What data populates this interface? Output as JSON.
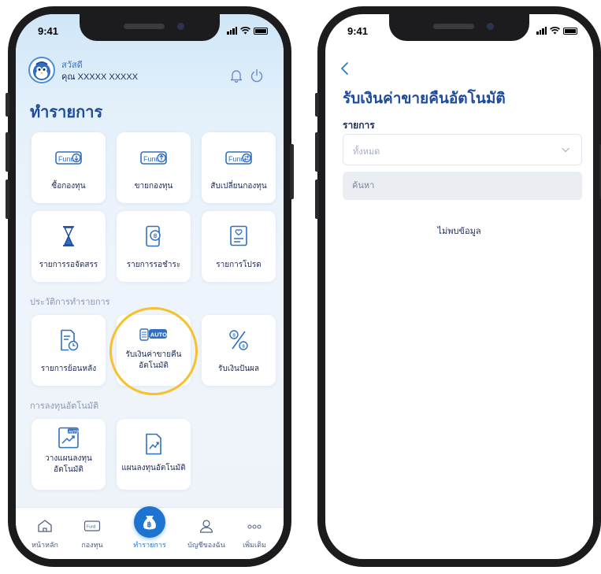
{
  "status_bar": {
    "time": "9:41"
  },
  "home": {
    "greeting": "สวัสดี",
    "user_name": "คุณ XXXXX XXXXX",
    "heading": "ทำรายการ",
    "transaction_tiles": [
      {
        "label": "ซื้อกองทุน",
        "icon": "fund-buy-icon"
      },
      {
        "label": "ขายกองทุน",
        "icon": "fund-sell-icon"
      },
      {
        "label": "สับเปลี่ยนกองทุน",
        "icon": "fund-switch-icon"
      },
      {
        "label": "รายการรอจัดสรร",
        "icon": "hourglass-icon"
      },
      {
        "label": "รายการรอชำระ",
        "icon": "payment-pending-icon"
      },
      {
        "label": "รายการโปรด",
        "icon": "favorite-list-icon"
      }
    ],
    "history_section": "ประวัติการทำรายการ",
    "history_tiles": [
      {
        "label": "รายการย้อนหลัง",
        "icon": "history-document-icon"
      },
      {
        "label_line1": "รับเงินค่าขายคืน",
        "label_line2": "อัตโนมัติ",
        "icon": "auto-redemption-icon",
        "auto_text": "AUTO"
      },
      {
        "label": "รับเงินปันผล",
        "icon": "dividend-percent-icon"
      }
    ],
    "auto_invest_section": "การลงทุนอัตโนมัติ",
    "auto_invest_tiles": [
      {
        "label_line1": "วางแผนลงทุน",
        "label_line2": "อัตโนมัติ",
        "icon": "auto-plan-icon",
        "auto_text": "AUTO"
      },
      {
        "label": "แผนลงทุนอัตโนมัติ",
        "icon": "auto-plan-chart-icon"
      }
    ],
    "tabs": [
      {
        "label": "หน้าหลัก",
        "icon": "home-icon"
      },
      {
        "label": "กองทุน",
        "icon": "fund-icon"
      },
      {
        "label": "ทำรายการ",
        "icon": "transaction-icon",
        "active": true
      },
      {
        "label": "บัญชีของฉัน",
        "icon": "account-icon"
      },
      {
        "label": "เพิ่มเติม",
        "icon": "more-icon"
      }
    ],
    "fund_icon_text": "Fund"
  },
  "detail": {
    "title": "รับเงินค่าขายคืนอัตโนมัติ",
    "filter_label": "รายการ",
    "filter_value": "ทั้งหมด",
    "search_placeholder": "ค้นหา",
    "empty_message": "ไม่พบข้อมูล"
  },
  "colors": {
    "primary": "#1d4a9a",
    "accent": "#1f73d0",
    "highlight_ring": "#f7c12c"
  }
}
